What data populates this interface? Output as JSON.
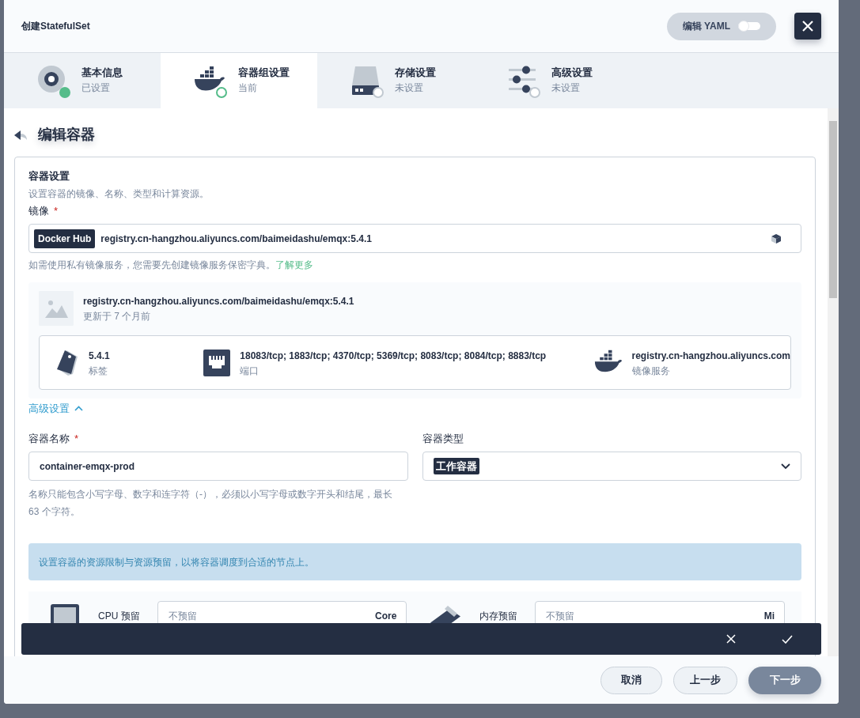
{
  "dialog": {
    "title": "创建StatefulSet",
    "yaml_toggle": {
      "label": "编辑 YAML",
      "on": false
    }
  },
  "steps": [
    {
      "kind": "basic",
      "title": "基本信息",
      "status": "已设置",
      "done": true,
      "selected": false
    },
    {
      "kind": "container",
      "title": "容器组设置",
      "status": "当前",
      "done": false,
      "selected": true
    },
    {
      "kind": "storage",
      "title": "存储设置",
      "status": "未设置",
      "done": false,
      "selected": false
    },
    {
      "kind": "advanced",
      "title": "高级设置",
      "status": "未设置",
      "done": false,
      "selected": false
    }
  ],
  "section_title": "编辑容器",
  "container_settings": {
    "title": "容器设置",
    "description": "设置容器的镜像、名称、类型和计算资源。",
    "image_label": "镜像",
    "required_mark": "*",
    "registry_tag": "Docker Hub",
    "image_value": "registry.cn-hangzhou.aliyuncs.com/baimeidashu/emqx:5.4.1",
    "hint": "如需使用私有镜像服务，您需要先创建镜像服务保密字典。",
    "hint_link": "了解更多"
  },
  "image_info": {
    "name": "registry.cn-hangzhou.aliyuncs.com/baimeidashu/emqx:5.4.1",
    "updated": "更新于 7 个月前",
    "details": [
      {
        "kind": "tag",
        "value": "5.4.1",
        "label": "标签"
      },
      {
        "kind": "port",
        "value": "18083/tcp; 1883/tcp; 4370/tcp; 5369/tcp; 8083/tcp; 8084/tcp; 8883/tcp",
        "label": "端口"
      },
      {
        "kind": "registry",
        "value": "registry.cn-hangzhou.aliyuncs.com",
        "label": "镜像服务"
      }
    ]
  },
  "advanced_toggle": {
    "label": "高级设置",
    "expanded": true
  },
  "name_field": {
    "label": "容器名称",
    "required_mark": "*",
    "value": "container-emqx-prod",
    "hint": "名称只能包含小写字母、数字和连字符（-），必须以小写字母或数字开头和结尾，最长 63 个字符。"
  },
  "type_field": {
    "label": "容器类型",
    "value": "工作容器"
  },
  "resources": {
    "notice": "设置容器的资源限制与资源预留，以将容器调度到合适的节点上。",
    "rows": [
      {
        "kind": "cpu",
        "label": "CPU 预留",
        "placeholder": "不预留",
        "unit": "Core"
      },
      {
        "kind": "memory",
        "label": "内存预留",
        "placeholder": "不预留",
        "unit": "Mi"
      }
    ]
  },
  "footer": {
    "buttons": [
      {
        "kind": "secondary",
        "label": "取消"
      },
      {
        "kind": "secondary",
        "label": "上一步"
      },
      {
        "kind": "primary",
        "label": "下一步"
      }
    ]
  }
}
